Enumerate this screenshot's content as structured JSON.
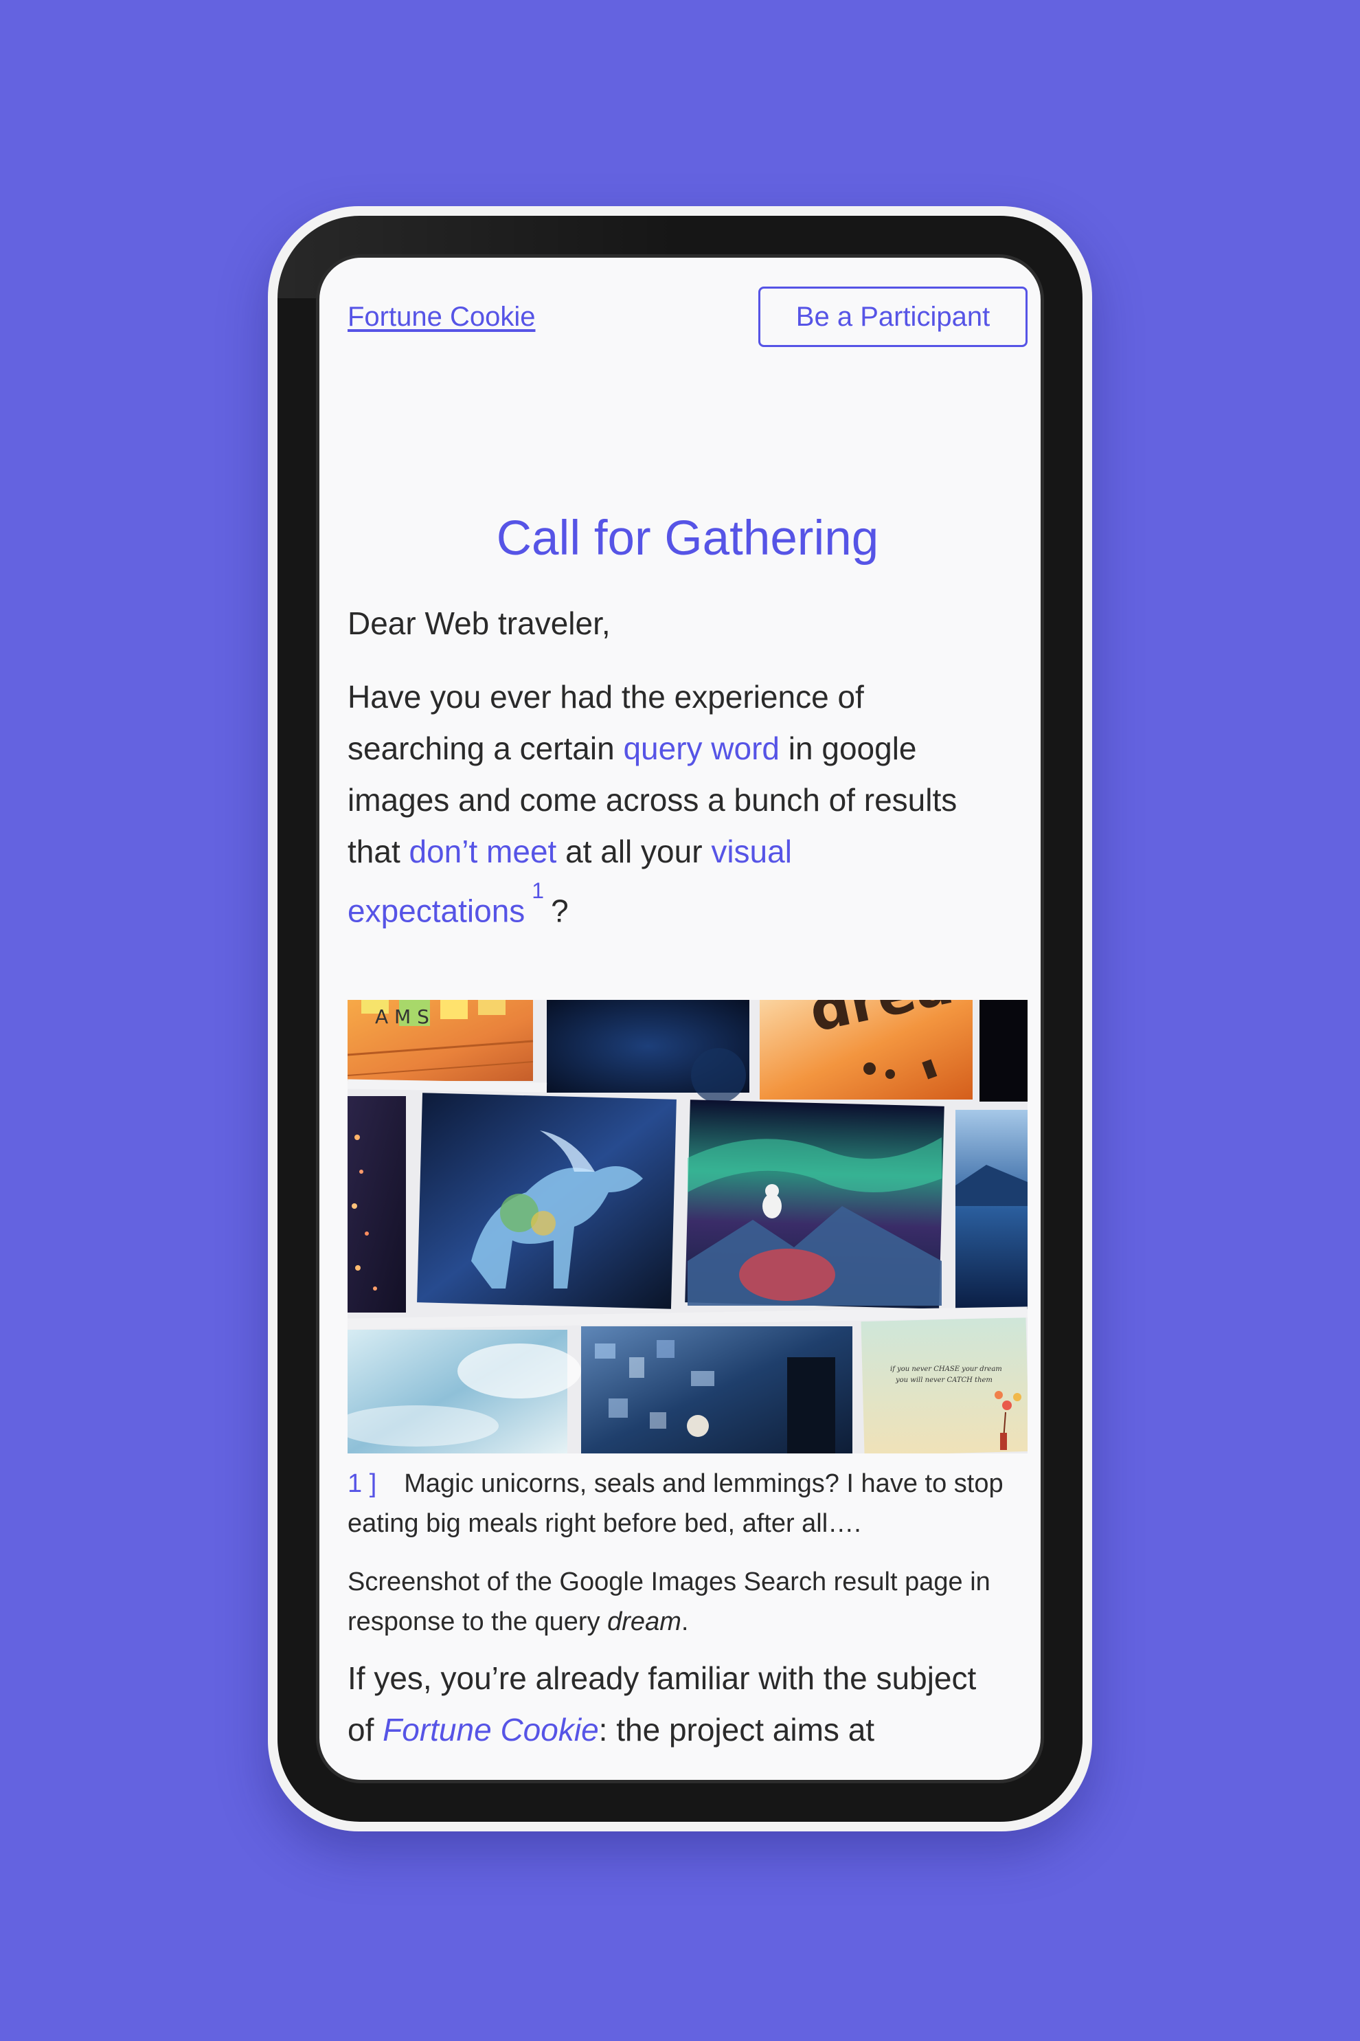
{
  "header": {
    "brand_link": "Fortune Cookie",
    "participant_button": "Be a Participant"
  },
  "main": {
    "title": "Call for Gathering",
    "greeting": "Dear Web traveler,",
    "intro": {
      "part1": "Have you ever had the experience of searching a certain ",
      "link_query_word": "query word",
      "part2": " in google images and come across a bunch of results that ",
      "link_dont_meet": "don’t meet",
      "part3": " at all your ",
      "link_visual_expectations": "visual expectations",
      "footnote_ref": "1",
      "part4": "?"
    },
    "figure": {
      "tile_text_letters": "A M S",
      "tile_text_dream": "drea",
      "tile_text_quote_line1": "if you never CHASE your dream",
      "tile_text_quote_line2": "you will never CATCH them"
    },
    "note": {
      "marker": "1 ]",
      "text": "Magic unicorns, seals and lemmings? I have to stop eating big meals right before bed, after all…."
    },
    "caption": {
      "text_before": "Screenshot of the Google Images Search result page in response to the query ",
      "query": "dream",
      "text_after": "."
    },
    "continuation": {
      "text_before": "If yes, you’re already familiar with the subject of ",
      "project_name": "Fortune Cookie",
      "text_after": ": the project aims at"
    }
  },
  "colors": {
    "background": "#6463e0",
    "accent": "#5654e6",
    "text": "#2a2a2a",
    "screen": "#f9f9fa"
  }
}
